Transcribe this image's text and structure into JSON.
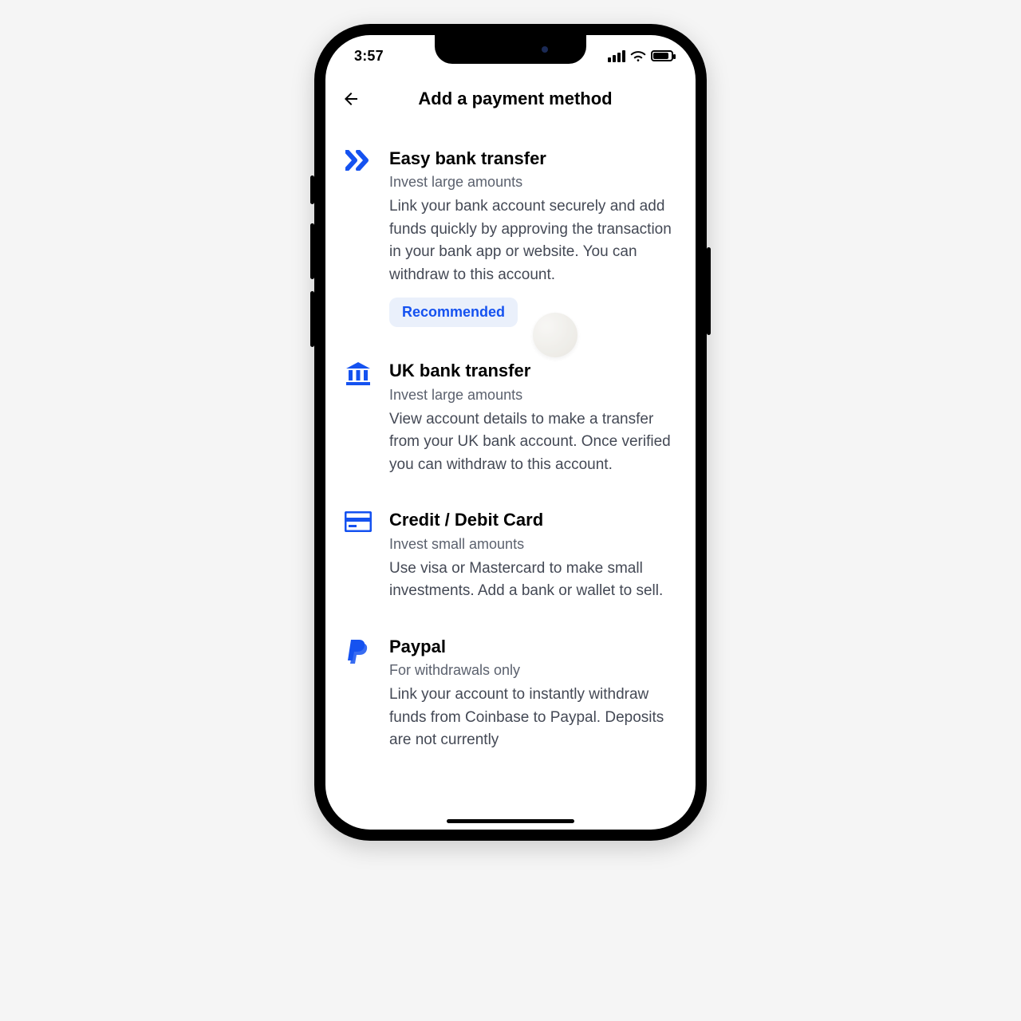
{
  "status": {
    "time": "3:57"
  },
  "header": {
    "title": "Add a payment method"
  },
  "methods": [
    {
      "title": "Easy bank transfer",
      "subtitle": "Invest large amounts",
      "description": "Link your bank account securely and add funds quickly by approving the transaction in your bank app or website. You can withdraw to this account.",
      "badge": "Recommended"
    },
    {
      "title": "UK bank transfer",
      "subtitle": "Invest large amounts",
      "description": "View account details to make a transfer from your UK bank account. Once verified you can withdraw to this account."
    },
    {
      "title": "Credit / Debit Card",
      "subtitle": "Invest small amounts",
      "description": "Use visa or Mastercard to make small investments. Add a bank or wallet to sell."
    },
    {
      "title": "Paypal",
      "subtitle": "For withdrawals only",
      "description": "Link your account to instantly withdraw funds from Coinbase to Paypal. Deposits are not currently"
    }
  ],
  "colors": {
    "accent": "#1552F0",
    "muted": "#5b616e"
  }
}
